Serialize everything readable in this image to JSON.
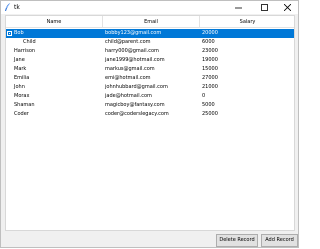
{
  "window": {
    "title": "tk"
  },
  "tree": {
    "columns": [
      "Name",
      "Email",
      "Salary"
    ],
    "rows": [
      {
        "name": "Bob",
        "email": "bobby123@gmail.com",
        "salary": "20000"
      },
      {
        "name": "Child",
        "email": "child@parent.com",
        "salary": "6000"
      },
      {
        "name": "Harrison",
        "email": "harry000@gmail.com",
        "salary": "23000"
      },
      {
        "name": "Jane",
        "email": "jane1999@hotmail.com",
        "salary": "19000"
      },
      {
        "name": "Mark",
        "email": "markus@gmail.com",
        "salary": "15000"
      },
      {
        "name": "Emilia",
        "email": "emi@hotmail.com",
        "salary": "27000"
      },
      {
        "name": "John",
        "email": "johnhubbard@gmail.com",
        "salary": "21000"
      },
      {
        "name": "Morax",
        "email": "jade@hotmail.com",
        "salary": "0"
      },
      {
        "name": "Shaman",
        "email": "magicboy@fantasy.com",
        "salary": "5000"
      },
      {
        "name": "Coder",
        "email": "coder@coderslegacy.com",
        "salary": "25000"
      }
    ]
  },
  "buttons": {
    "delete": "Delete Record",
    "add": "Add Record"
  },
  "colors": {
    "selection": "#0078d7"
  }
}
